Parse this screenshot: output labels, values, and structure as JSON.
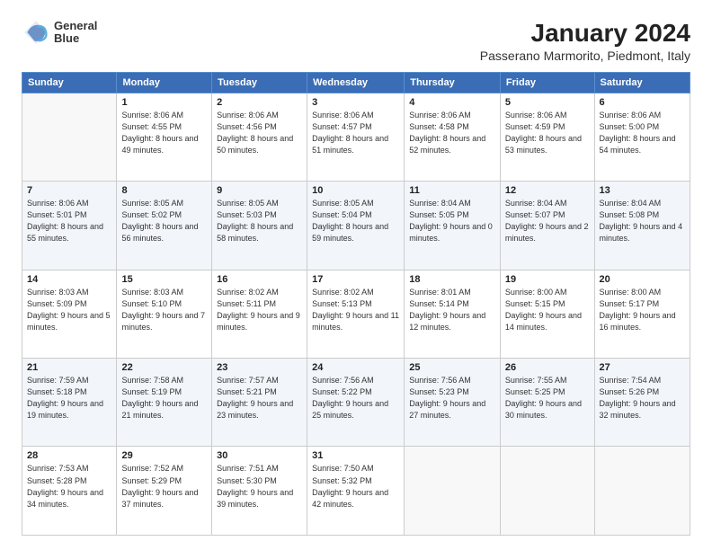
{
  "logo": {
    "line1": "General",
    "line2": "Blue"
  },
  "title": "January 2024",
  "subtitle": "Passerano Marmorito, Piedmont, Italy",
  "header_days": [
    "Sunday",
    "Monday",
    "Tuesday",
    "Wednesday",
    "Thursday",
    "Friday",
    "Saturday"
  ],
  "weeks": [
    [
      {
        "num": "",
        "sunrise": "",
        "sunset": "",
        "daylight": ""
      },
      {
        "num": "1",
        "sunrise": "Sunrise: 8:06 AM",
        "sunset": "Sunset: 4:55 PM",
        "daylight": "Daylight: 8 hours and 49 minutes."
      },
      {
        "num": "2",
        "sunrise": "Sunrise: 8:06 AM",
        "sunset": "Sunset: 4:56 PM",
        "daylight": "Daylight: 8 hours and 50 minutes."
      },
      {
        "num": "3",
        "sunrise": "Sunrise: 8:06 AM",
        "sunset": "Sunset: 4:57 PM",
        "daylight": "Daylight: 8 hours and 51 minutes."
      },
      {
        "num": "4",
        "sunrise": "Sunrise: 8:06 AM",
        "sunset": "Sunset: 4:58 PM",
        "daylight": "Daylight: 8 hours and 52 minutes."
      },
      {
        "num": "5",
        "sunrise": "Sunrise: 8:06 AM",
        "sunset": "Sunset: 4:59 PM",
        "daylight": "Daylight: 8 hours and 53 minutes."
      },
      {
        "num": "6",
        "sunrise": "Sunrise: 8:06 AM",
        "sunset": "Sunset: 5:00 PM",
        "daylight": "Daylight: 8 hours and 54 minutes."
      }
    ],
    [
      {
        "num": "7",
        "sunrise": "Sunrise: 8:06 AM",
        "sunset": "Sunset: 5:01 PM",
        "daylight": "Daylight: 8 hours and 55 minutes."
      },
      {
        "num": "8",
        "sunrise": "Sunrise: 8:05 AM",
        "sunset": "Sunset: 5:02 PM",
        "daylight": "Daylight: 8 hours and 56 minutes."
      },
      {
        "num": "9",
        "sunrise": "Sunrise: 8:05 AM",
        "sunset": "Sunset: 5:03 PM",
        "daylight": "Daylight: 8 hours and 58 minutes."
      },
      {
        "num": "10",
        "sunrise": "Sunrise: 8:05 AM",
        "sunset": "Sunset: 5:04 PM",
        "daylight": "Daylight: 8 hours and 59 minutes."
      },
      {
        "num": "11",
        "sunrise": "Sunrise: 8:04 AM",
        "sunset": "Sunset: 5:05 PM",
        "daylight": "Daylight: 9 hours and 0 minutes."
      },
      {
        "num": "12",
        "sunrise": "Sunrise: 8:04 AM",
        "sunset": "Sunset: 5:07 PM",
        "daylight": "Daylight: 9 hours and 2 minutes."
      },
      {
        "num": "13",
        "sunrise": "Sunrise: 8:04 AM",
        "sunset": "Sunset: 5:08 PM",
        "daylight": "Daylight: 9 hours and 4 minutes."
      }
    ],
    [
      {
        "num": "14",
        "sunrise": "Sunrise: 8:03 AM",
        "sunset": "Sunset: 5:09 PM",
        "daylight": "Daylight: 9 hours and 5 minutes."
      },
      {
        "num": "15",
        "sunrise": "Sunrise: 8:03 AM",
        "sunset": "Sunset: 5:10 PM",
        "daylight": "Daylight: 9 hours and 7 minutes."
      },
      {
        "num": "16",
        "sunrise": "Sunrise: 8:02 AM",
        "sunset": "Sunset: 5:11 PM",
        "daylight": "Daylight: 9 hours and 9 minutes."
      },
      {
        "num": "17",
        "sunrise": "Sunrise: 8:02 AM",
        "sunset": "Sunset: 5:13 PM",
        "daylight": "Daylight: 9 hours and 11 minutes."
      },
      {
        "num": "18",
        "sunrise": "Sunrise: 8:01 AM",
        "sunset": "Sunset: 5:14 PM",
        "daylight": "Daylight: 9 hours and 12 minutes."
      },
      {
        "num": "19",
        "sunrise": "Sunrise: 8:00 AM",
        "sunset": "Sunset: 5:15 PM",
        "daylight": "Daylight: 9 hours and 14 minutes."
      },
      {
        "num": "20",
        "sunrise": "Sunrise: 8:00 AM",
        "sunset": "Sunset: 5:17 PM",
        "daylight": "Daylight: 9 hours and 16 minutes."
      }
    ],
    [
      {
        "num": "21",
        "sunrise": "Sunrise: 7:59 AM",
        "sunset": "Sunset: 5:18 PM",
        "daylight": "Daylight: 9 hours and 19 minutes."
      },
      {
        "num": "22",
        "sunrise": "Sunrise: 7:58 AM",
        "sunset": "Sunset: 5:19 PM",
        "daylight": "Daylight: 9 hours and 21 minutes."
      },
      {
        "num": "23",
        "sunrise": "Sunrise: 7:57 AM",
        "sunset": "Sunset: 5:21 PM",
        "daylight": "Daylight: 9 hours and 23 minutes."
      },
      {
        "num": "24",
        "sunrise": "Sunrise: 7:56 AM",
        "sunset": "Sunset: 5:22 PM",
        "daylight": "Daylight: 9 hours and 25 minutes."
      },
      {
        "num": "25",
        "sunrise": "Sunrise: 7:56 AM",
        "sunset": "Sunset: 5:23 PM",
        "daylight": "Daylight: 9 hours and 27 minutes."
      },
      {
        "num": "26",
        "sunrise": "Sunrise: 7:55 AM",
        "sunset": "Sunset: 5:25 PM",
        "daylight": "Daylight: 9 hours and 30 minutes."
      },
      {
        "num": "27",
        "sunrise": "Sunrise: 7:54 AM",
        "sunset": "Sunset: 5:26 PM",
        "daylight": "Daylight: 9 hours and 32 minutes."
      }
    ],
    [
      {
        "num": "28",
        "sunrise": "Sunrise: 7:53 AM",
        "sunset": "Sunset: 5:28 PM",
        "daylight": "Daylight: 9 hours and 34 minutes."
      },
      {
        "num": "29",
        "sunrise": "Sunrise: 7:52 AM",
        "sunset": "Sunset: 5:29 PM",
        "daylight": "Daylight: 9 hours and 37 minutes."
      },
      {
        "num": "30",
        "sunrise": "Sunrise: 7:51 AM",
        "sunset": "Sunset: 5:30 PM",
        "daylight": "Daylight: 9 hours and 39 minutes."
      },
      {
        "num": "31",
        "sunrise": "Sunrise: 7:50 AM",
        "sunset": "Sunset: 5:32 PM",
        "daylight": "Daylight: 9 hours and 42 minutes."
      },
      {
        "num": "",
        "sunrise": "",
        "sunset": "",
        "daylight": ""
      },
      {
        "num": "",
        "sunrise": "",
        "sunset": "",
        "daylight": ""
      },
      {
        "num": "",
        "sunrise": "",
        "sunset": "",
        "daylight": ""
      }
    ]
  ]
}
